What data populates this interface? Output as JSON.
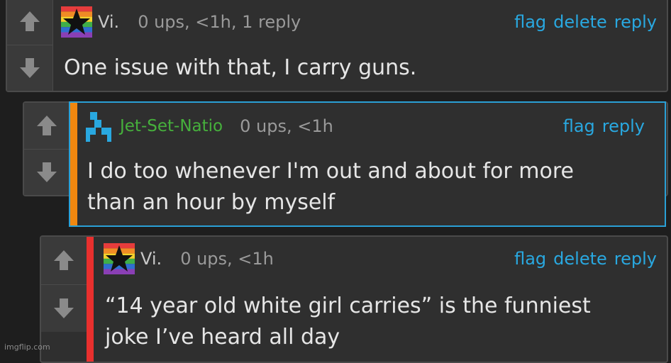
{
  "comments": [
    {
      "username": "Vi.",
      "meta": "0 ups, <1h, 1 reply",
      "actions": {
        "flag": "flag",
        "delete": "delete",
        "reply": "reply"
      },
      "text": "One issue with that, I carry guns.",
      "avatar_icon": "rainbow-star-avatar-icon"
    },
    {
      "username": "Jet-Set-Natio",
      "username_color": "#46b03c",
      "meta": "0 ups, <1h",
      "actions": {
        "flag": "flag",
        "reply": "reply"
      },
      "text_line1": "I do too whenever I'm out and about for more",
      "text_line2": "than an hour by myself",
      "bar_color": "#f0870f",
      "highlight_border": "#2aa0d6",
      "avatar_icon": "blue-blocks-avatar-icon"
    },
    {
      "username": "Vi.",
      "meta": "0 ups, <1h",
      "actions": {
        "flag": "flag",
        "delete": "delete",
        "reply": "reply"
      },
      "text_line1": "“14 year old white girl carries” is the funniest",
      "text_line2": "joke I’ve heard all day",
      "bar_color": "#e8302e",
      "avatar_icon": "rainbow-star-avatar-icon"
    }
  ],
  "colors": {
    "link": "#29a8e0",
    "meta": "#9a9a9a",
    "text": "#e6e6e6",
    "background": "#1e1e1e"
  },
  "watermark": "imgflip.com"
}
